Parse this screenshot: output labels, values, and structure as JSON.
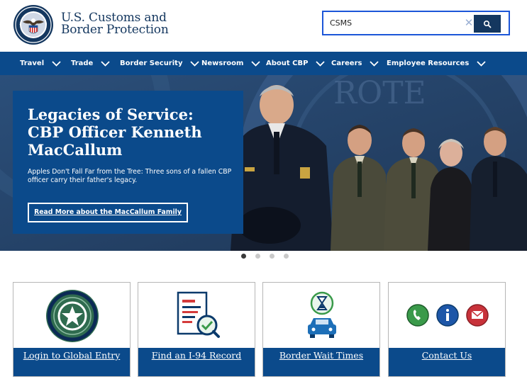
{
  "header": {
    "brand_line1": "U.S. Customs and",
    "brand_line2": "Border Protection",
    "logo": "cbp-seal"
  },
  "search": {
    "value": "CSMS",
    "clear_icon": "close-icon",
    "button_icon": "search-icon"
  },
  "nav": {
    "items": [
      {
        "label": "Travel"
      },
      {
        "label": "Trade"
      },
      {
        "label": "Border Security"
      },
      {
        "label": "Newsroom"
      },
      {
        "label": "About CBP"
      },
      {
        "label": "Careers"
      },
      {
        "label": "Employee Resources"
      }
    ],
    "chevron_icon": "chevron-down-icon"
  },
  "hero": {
    "title": "Legacies of Service: CBP Officer Kenneth MacCallum",
    "description": "Apples Don't Fall Far from the Tree: Three sons of a fallen CBP officer carry their father's legacy.",
    "button_label": "Read More about the MacCallum Family",
    "slides": 4,
    "active_slide": 1
  },
  "cards": [
    {
      "label": "Login to Global Entry",
      "icon": "global-entry-icon"
    },
    {
      "label": "Find an I-94 Record",
      "icon": "document-search-icon"
    },
    {
      "label": "Border Wait Times",
      "icon": "hourglass-car-icon"
    },
    {
      "label": "Contact Us",
      "icon": "contact-icons"
    }
  ],
  "colors": {
    "navy": "#0b4a8b",
    "dark_navy": "#14375f",
    "search_border": "#1c56d8"
  }
}
